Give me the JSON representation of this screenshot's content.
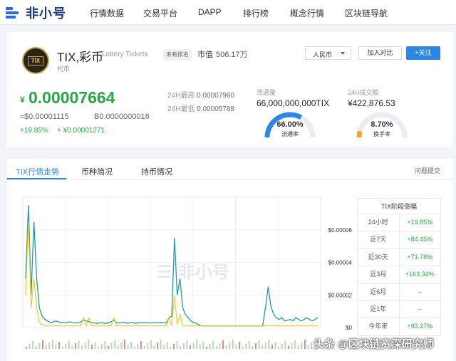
{
  "brand": {
    "name": "非小号"
  },
  "nav": {
    "items": [
      "行情数据",
      "交易平台",
      "DAPP",
      "排行榜",
      "概念行情",
      "区块链导航"
    ]
  },
  "coin": {
    "logo_text": "TIX",
    "name": "TIX,彩币",
    "en_name": "Lottery Tickets",
    "type": "代币",
    "rank_badge": "未有排名",
    "mcap_label": "市值",
    "mcap_value": "506.17万"
  },
  "actions": {
    "currency": "人民币",
    "compare": "加入对比",
    "follow": "+关注"
  },
  "price": {
    "symbol": "¥",
    "main": "0.00007664",
    "usd": "≈$0.00001115",
    "btc": "B0.0000000016",
    "change_pct": "+19.85%",
    "change_abs": "+ ¥0.00001271"
  },
  "high_low": {
    "high_label": "24H最高",
    "high_value": "0.00007960",
    "low_label": "24H最低",
    "low_value": "0.00005788"
  },
  "supply": {
    "label": "流通量",
    "value": "66,000,000,000TIX",
    "gauge_value": "66.00%",
    "gauge_label": "流通率",
    "fraction": 0.66,
    "color": "#2b87e3"
  },
  "volume": {
    "label": "24H成交额",
    "value": "¥422,876.53",
    "gauge_value": "8.70%",
    "gauge_label": "换手率",
    "fraction": 0.087,
    "color": "#f5a623"
  },
  "tabs": {
    "items": [
      "TIX行情走势",
      "币种简况",
      "持币情况"
    ],
    "feedback": "问题提交"
  },
  "range_table": {
    "title": "TIX阶段涨幅",
    "rows": [
      {
        "period": "24小时",
        "change": "+19.85%",
        "dir": "up"
      },
      {
        "period": "近7天",
        "change": "+84.45%",
        "dir": "up"
      },
      {
        "period": "近30天",
        "change": "+71.78%",
        "dir": "up"
      },
      {
        "period": "近3月",
        "change": "+163.34%",
        "dir": "up"
      },
      {
        "period": "近6月",
        "change": "--",
        "dir": "flat"
      },
      {
        "period": "近1年",
        "change": "--",
        "dir": "flat"
      },
      {
        "period": "今年来",
        "change": "+93.27%",
        "dir": "up"
      }
    ]
  },
  "chart_data": {
    "type": "line",
    "ylabel": "",
    "y_ticks": [
      "$0.00006",
      "$0.00004",
      "$0.00002",
      "$0"
    ],
    "ylim": [
      0,
      8e-05
    ],
    "watermark": "非小号",
    "series": [
      {
        "color": "#1f9aa8",
        "values": [
          3e-05,
          7.5e-05,
          2e-05,
          6.5e-05,
          3e-05,
          1.2e-05,
          7e-06,
          5e-06,
          4e-06,
          3e-06,
          3.5e-06,
          4e-06,
          3.5e-06,
          3e-06,
          3e-06,
          3.2e-06,
          3.5e-06,
          3e-06,
          2.8e-06,
          3e-06,
          3.5e-06,
          4.5e-06,
          4e-06,
          3.5e-06,
          3e-06,
          2.8e-06,
          2.5e-06,
          3e-06,
          2.8e-06,
          2.5e-06,
          3e-06,
          3.5e-06,
          4.5e-06,
          3e-06,
          2.8e-06,
          3e-06,
          3.2e-06,
          2.5e-06,
          3e-06,
          3e-06,
          2.5e-06,
          3e-06,
          2.8e-06,
          3e-06,
          3e-06,
          2.8e-06,
          3e-06,
          3e-06,
          3e-06,
          3.2e-06,
          3e-06,
          2.8e-06,
          6e-06,
          7e-06,
          5.5e-05,
          2e-05,
          3e-05,
          1.2e-05,
          8e-06,
          6e-06,
          4e-06,
          3e-06,
          2.5e-06,
          1.5e-06,
          1e-06,
          1e-06,
          1e-06,
          1e-06,
          1e-06,
          1e-06,
          1e-06,
          1e-06,
          1e-06,
          1e-06,
          1e-06,
          1e-06,
          1e-06,
          1e-06,
          1e-06,
          1e-06,
          1e-06,
          1e-06,
          1e-06,
          1e-06,
          1e-06,
          1e-06,
          1e-06,
          1.2e-05,
          2.5e-05,
          1.3e-05,
          8e-06,
          6e-06,
          5e-06,
          6e-06,
          4e-06,
          4.5e-06,
          5e-06,
          4e-06,
          6e-06,
          5e-06,
          4e-06,
          5e-06,
          6e-06,
          5e-06,
          4e-06,
          5e-06,
          6e-06
        ]
      },
      {
        "color": "#f5c518",
        "values": [
          2e-05,
          6.5e-05,
          1.2e-05,
          3e-05,
          1.2e-05,
          3e-06,
          2e-06,
          1e-06,
          1e-06,
          1e-06,
          1e-06,
          1e-06,
          1e-06,
          1e-06,
          1e-06,
          1e-06,
          1e-06,
          1e-06,
          1e-06,
          1e-06,
          1e-06,
          6e-06,
          1e-06,
          6e-06,
          1e-06,
          1e-06,
          1e-06,
          1e-06,
          1e-06,
          1e-06,
          1e-06,
          1e-06,
          6e-06,
          1e-06,
          1e-06,
          1e-06,
          1e-06,
          1e-06,
          1e-06,
          1e-06,
          1e-06,
          1e-06,
          1e-06,
          1e-06,
          1e-06,
          1e-06,
          1e-06,
          1e-06,
          1e-06,
          1e-06,
          1e-06,
          1e-06,
          6e-06,
          1e-06,
          2e-05,
          2e-06,
          8e-06,
          1e-06,
          1e-06,
          1e-06,
          1e-06,
          1e-06,
          1e-06,
          1e-06,
          1e-06,
          1e-06,
          1e-06,
          1e-06,
          1e-06,
          1e-06,
          1e-06,
          1e-06,
          1e-06,
          1e-06,
          1e-06,
          1e-06,
          1e-06,
          1e-06,
          1e-06,
          1e-06,
          1e-06,
          1e-06,
          1e-06,
          1e-06,
          1e-06,
          1e-06,
          1e-06,
          1e-06,
          1e-06,
          1e-06,
          1e-06,
          1e-06,
          1e-06,
          1e-06,
          1e-06,
          1e-06,
          1e-06,
          1e-06,
          1e-06,
          1e-06,
          1e-06,
          1e-06,
          1e-06,
          1e-06,
          1e-06,
          1e-06,
          1e-06
        ]
      }
    ]
  },
  "watermark_caption": "头条 @区块链资深研究师"
}
